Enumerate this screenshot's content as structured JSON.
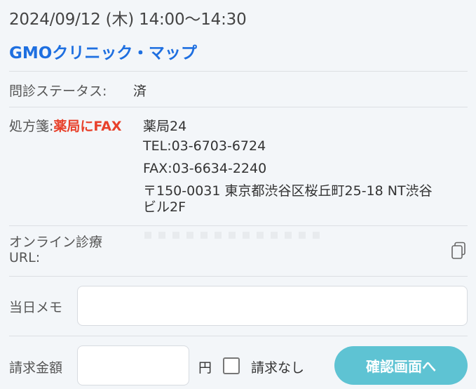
{
  "appointment": {
    "datetime": "2024/09/12 (木) 14:00〜14:30",
    "clinic_name": "GMOクリニック・マップ"
  },
  "interview": {
    "label": "問診ステータス:",
    "value": "済"
  },
  "prescription": {
    "label": "処方箋:",
    "delivery": "薬局にFAX",
    "pharmacy_name": "薬局24",
    "tel": "TEL:03-6703-6724",
    "fax": "FAX:03-6634-2240",
    "address_line1": "〒150-0031 東京都渋谷区桜丘町25-18 NT渋谷",
    "address_line2": "ビル2F"
  },
  "online": {
    "label_line1": "オンライン診療",
    "label_line2": "URL:"
  },
  "memo": {
    "label": "当日メモ",
    "value": ""
  },
  "billing": {
    "label": "請求金額",
    "amount": "",
    "unit": "円",
    "no_charge_label": "請求なし",
    "no_charge_checked": false,
    "confirm_button": "確認画面へ"
  },
  "colors": {
    "accent_blue": "#1e6fe0",
    "fax_red": "#e8412b",
    "button_teal": "#5ec3d3"
  }
}
